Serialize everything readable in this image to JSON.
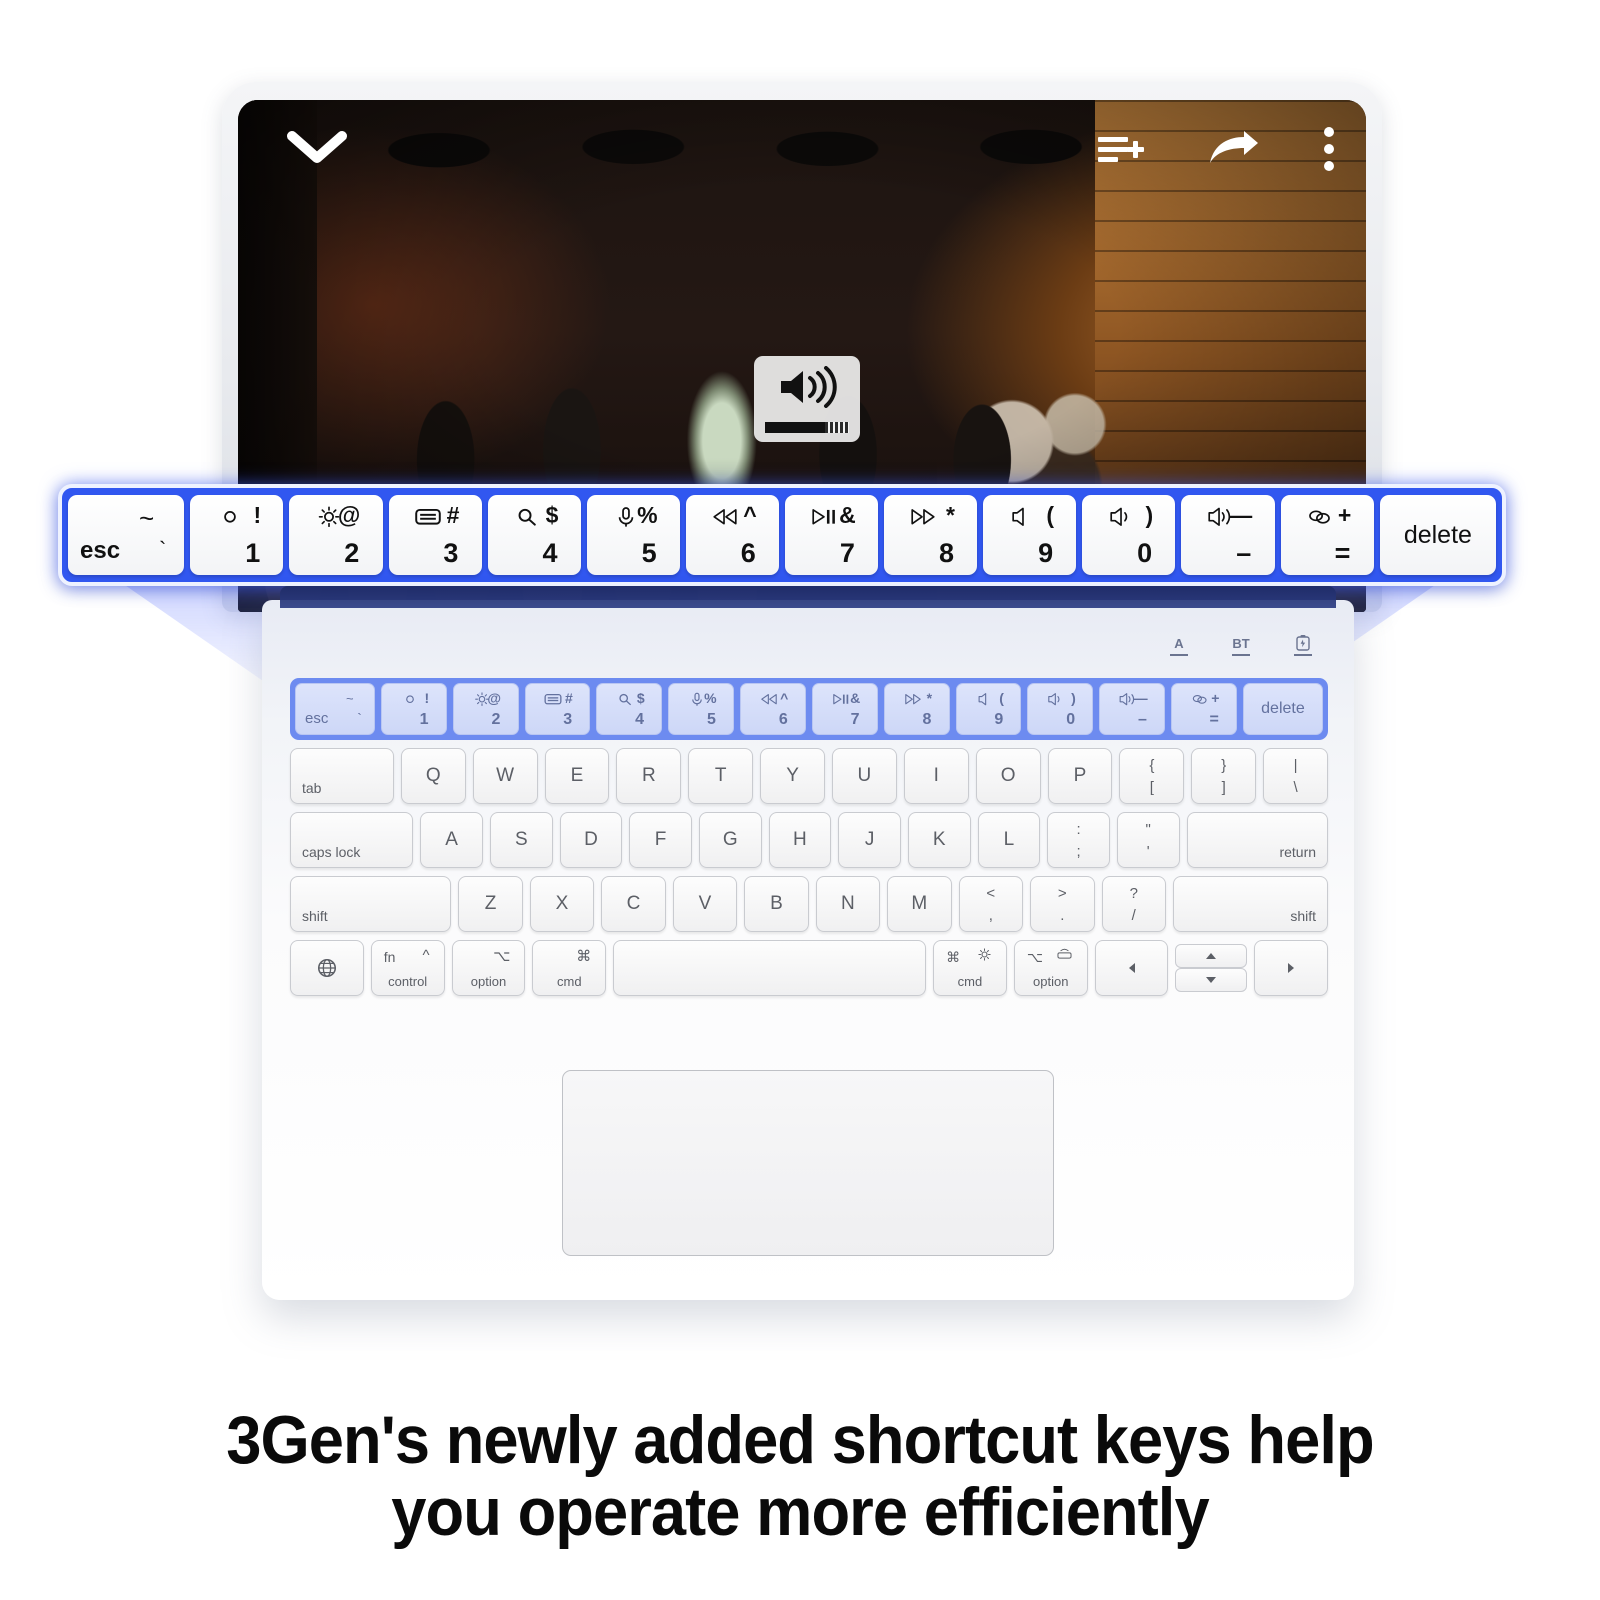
{
  "product": {
    "caption_line1": "3Gen's newly added shortcut keys help",
    "caption_line2": "you operate more efficiently"
  },
  "player": {
    "minimize_icon": "chevron-down-icon",
    "add_to_queue_icon": "add-to-playlist-icon",
    "share_icon": "share-arrow-icon",
    "more_icon": "more-vertical-icon",
    "volume_hud": {
      "icon": "speaker-volume-high-icon",
      "level_percent": 72
    }
  },
  "status_indicators": [
    {
      "label": "A",
      "name": "caps-lock-indicator"
    },
    {
      "label": "BT",
      "name": "bluetooth-indicator"
    },
    {
      "label": "",
      "name": "battery-indicator"
    }
  ],
  "function_row": [
    {
      "name": "esc",
      "label_left": "esc",
      "label_right": "`",
      "top_left": "~",
      "icon": ""
    },
    {
      "name": "brightness-down",
      "top_left": "○",
      "top_right": "!",
      "bottom": "1",
      "icon": "brightness-down-icon"
    },
    {
      "name": "brightness-up",
      "top_left": "",
      "top_right": "@",
      "bottom": "2",
      "icon": "brightness-up-icon"
    },
    {
      "name": "onscreen-keyboard",
      "top_left": "",
      "top_right": "#",
      "bottom": "3",
      "icon": "keyboard-icon"
    },
    {
      "name": "search",
      "top_left": "",
      "top_right": "$",
      "bottom": "4",
      "icon": "search-icon"
    },
    {
      "name": "dictation",
      "top_left": "",
      "top_right": "%",
      "bottom": "5",
      "icon": "microphone-icon"
    },
    {
      "name": "previous-track",
      "top_left": "",
      "top_right": "^",
      "bottom": "6",
      "icon": "rewind-icon"
    },
    {
      "name": "play-pause",
      "top_left": "",
      "top_right": "&",
      "bottom": "7",
      "icon": "play-pause-icon"
    },
    {
      "name": "next-track",
      "top_left": "",
      "top_right": "*",
      "bottom": "8",
      "icon": "fast-forward-icon"
    },
    {
      "name": "mute",
      "top_left": "",
      "top_right": "(",
      "bottom": "9",
      "icon": "speaker-mute-icon"
    },
    {
      "name": "volume-down",
      "top_left": "",
      "top_right": ")",
      "bottom": "0",
      "icon": "speaker-low-icon"
    },
    {
      "name": "volume-up",
      "top_left": "",
      "top_right": "—",
      "bottom": "–",
      "icon": "speaker-high-icon"
    },
    {
      "name": "lock",
      "top_left": "",
      "top_right": "+",
      "bottom": "=",
      "icon": "link-rings-icon"
    },
    {
      "name": "delete",
      "label_center": "delete",
      "icon": ""
    }
  ],
  "keyboard_rows": {
    "row_qwerty": [
      {
        "name": "tab",
        "label": "tab",
        "align": "left",
        "flex": 1.62
      },
      {
        "name": "q",
        "label": "Q"
      },
      {
        "name": "w",
        "label": "W"
      },
      {
        "name": "e",
        "label": "E"
      },
      {
        "name": "r",
        "label": "R"
      },
      {
        "name": "t",
        "label": "T"
      },
      {
        "name": "y",
        "label": "Y"
      },
      {
        "name": "u",
        "label": "U"
      },
      {
        "name": "i",
        "label": "I"
      },
      {
        "name": "o",
        "label": "O"
      },
      {
        "name": "p",
        "label": "P"
      },
      {
        "name": "bracket-left",
        "top": "{",
        "bottom": "["
      },
      {
        "name": "bracket-right",
        "top": "}",
        "bottom": "]"
      },
      {
        "name": "backslash",
        "top": "|",
        "bottom": "\\"
      }
    ],
    "row_home": [
      {
        "name": "caps-lock",
        "label": "caps lock",
        "align": "left",
        "flex": 2.0
      },
      {
        "name": "a",
        "label": "A"
      },
      {
        "name": "s",
        "label": "S"
      },
      {
        "name": "d",
        "label": "D"
      },
      {
        "name": "f",
        "label": "F"
      },
      {
        "name": "g",
        "label": "G"
      },
      {
        "name": "h",
        "label": "H"
      },
      {
        "name": "j",
        "label": "J"
      },
      {
        "name": "k",
        "label": "K"
      },
      {
        "name": "l",
        "label": "L"
      },
      {
        "name": "semicolon",
        "top": ":",
        "bottom": ";"
      },
      {
        "name": "quote",
        "top": "\"",
        "bottom": "'"
      },
      {
        "name": "return",
        "label": "return",
        "align": "right",
        "flex": 2.3
      }
    ],
    "row_shift": [
      {
        "name": "shift-left",
        "label": "shift",
        "align": "left",
        "flex": 2.55
      },
      {
        "name": "z",
        "label": "Z"
      },
      {
        "name": "x",
        "label": "X"
      },
      {
        "name": "c",
        "label": "C"
      },
      {
        "name": "v",
        "label": "V"
      },
      {
        "name": "b",
        "label": "B"
      },
      {
        "name": "n",
        "label": "N"
      },
      {
        "name": "m",
        "label": "M"
      },
      {
        "name": "comma",
        "top": "<",
        "bottom": ","
      },
      {
        "name": "period",
        "top": ">",
        "bottom": "."
      },
      {
        "name": "slash",
        "top": "?",
        "bottom": "/"
      },
      {
        "name": "shift-right",
        "label": "shift",
        "align": "right",
        "flex": 2.45
      }
    ],
    "row_bottom": [
      {
        "name": "globe",
        "icon": "globe-icon",
        "flex": 1.12
      },
      {
        "name": "control",
        "label": "control",
        "mod_tl": "fn",
        "mod_tr": "^",
        "flex": 1.12
      },
      {
        "name": "option-left",
        "label": "option",
        "mod_tr": "⌥",
        "flex": 1.12
      },
      {
        "name": "command-left",
        "label": "cmd",
        "mod_tr": "⌘",
        "flex": 1.12
      },
      {
        "name": "space",
        "label": "",
        "flex": 4.85
      },
      {
        "name": "command-right",
        "label": "cmd",
        "mod_tl": "⌘",
        "mod_tr": "brightness",
        "flex": 1.12
      },
      {
        "name": "option-right",
        "label": "option",
        "mod_tl": "⌥",
        "mod_tr": "backlight",
        "flex": 1.12
      },
      {
        "name": "arrow-left",
        "icon": "arrow-left-icon",
        "flex": 1.12
      },
      {
        "name": "arrow-updown",
        "icon": "arrow-up-down-icon",
        "flex": 1.12
      },
      {
        "name": "arrow-right",
        "icon": "arrow-right-icon",
        "flex": 1.12
      }
    ]
  }
}
